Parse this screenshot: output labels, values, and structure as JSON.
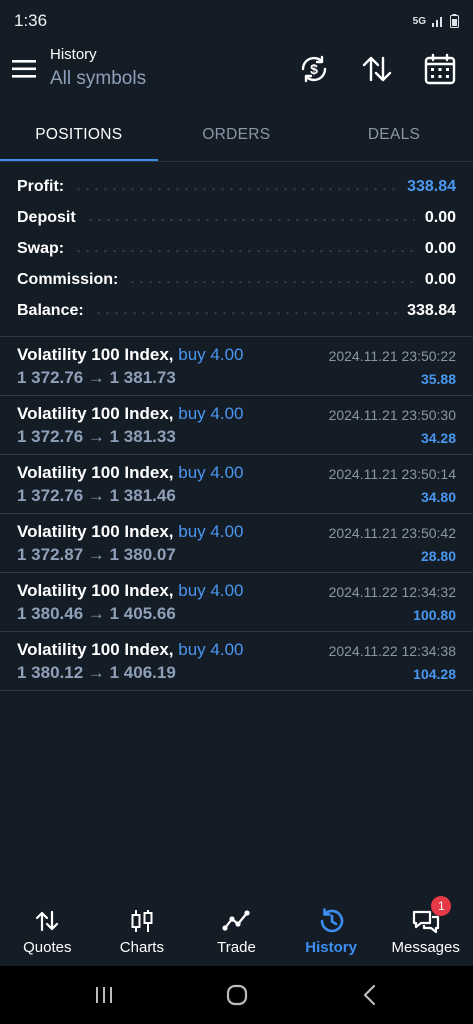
{
  "status_bar": {
    "time": "1:36",
    "network": "5G"
  },
  "header": {
    "title": "History",
    "subtitle": "All symbols"
  },
  "tabs": [
    {
      "label": "POSITIONS",
      "active": true
    },
    {
      "label": "ORDERS",
      "active": false
    },
    {
      "label": "DEALS",
      "active": false
    }
  ],
  "summary": [
    {
      "label": "Profit:",
      "value": "338.84",
      "highlight": true
    },
    {
      "label": "Deposit",
      "value": "0.00",
      "highlight": false
    },
    {
      "label": "Swap:",
      "value": "0.00",
      "highlight": false
    },
    {
      "label": "Commission:",
      "value": "0.00",
      "highlight": false
    },
    {
      "label": "Balance:",
      "value": "338.84",
      "highlight": false
    }
  ],
  "deals": [
    {
      "symbol": "Volatility 100 Index,",
      "side": "buy 4.00",
      "prices": "1 372.76 → 1 381.73",
      "time": "2024.11.21 23:50:22",
      "profit": "35.88"
    },
    {
      "symbol": "Volatility 100 Index,",
      "side": "buy 4.00",
      "prices": "1 372.76 → 1 381.33",
      "time": "2024.11.21 23:50:30",
      "profit": "34.28"
    },
    {
      "symbol": "Volatility 100 Index,",
      "side": "buy 4.00",
      "prices": "1 372.76 → 1 381.46",
      "time": "2024.11.21 23:50:14",
      "profit": "34.80"
    },
    {
      "symbol": "Volatility 100 Index,",
      "side": "buy 4.00",
      "prices": "1 372.87 → 1 380.07",
      "time": "2024.11.21 23:50:42",
      "profit": "28.80"
    },
    {
      "symbol": "Volatility 100 Index,",
      "side": "buy 4.00",
      "prices": "1 380.46 → 1 405.66",
      "time": "2024.11.22 12:34:32",
      "profit": "100.80"
    },
    {
      "symbol": "Volatility 100 Index,",
      "side": "buy 4.00",
      "prices": "1 380.12 → 1 406.19",
      "time": "2024.11.22 12:34:38",
      "profit": "104.28"
    }
  ],
  "bottom_nav": [
    {
      "label": "Quotes",
      "icon": "quotes-arrows-icon",
      "active": false
    },
    {
      "label": "Charts",
      "icon": "candlestick-icon",
      "active": false
    },
    {
      "label": "Trade",
      "icon": "trend-line-icon",
      "active": false
    },
    {
      "label": "History",
      "icon": "history-clock-icon",
      "active": true
    },
    {
      "label": "Messages",
      "icon": "chat-bubbles-icon",
      "active": false,
      "badge": "1"
    }
  ],
  "colors": {
    "background": "#141c26",
    "accent": "#3c8ff0",
    "muted": "#8ea0b8",
    "badge": "#e53945"
  }
}
